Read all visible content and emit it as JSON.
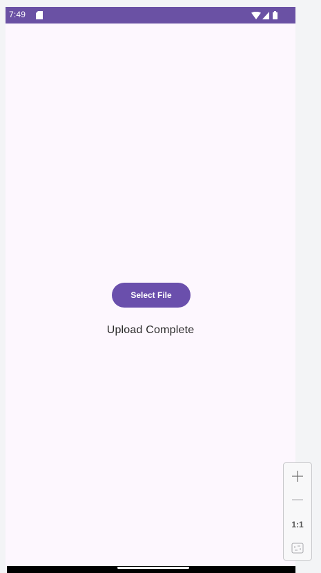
{
  "status_bar": {
    "time": "7:49",
    "color": "#6a51a4"
  },
  "app": {
    "background": "#fdf7fe",
    "select_file_label": "Select File",
    "upload_status": "Upload Complete",
    "accent": "#6a4fac"
  },
  "zoom_controls": {
    "zoom_in_icon": "plus-icon",
    "zoom_out_icon": "minus-icon",
    "actual_size_label": "1:1",
    "fit_icon": "fit-screen-icon"
  }
}
